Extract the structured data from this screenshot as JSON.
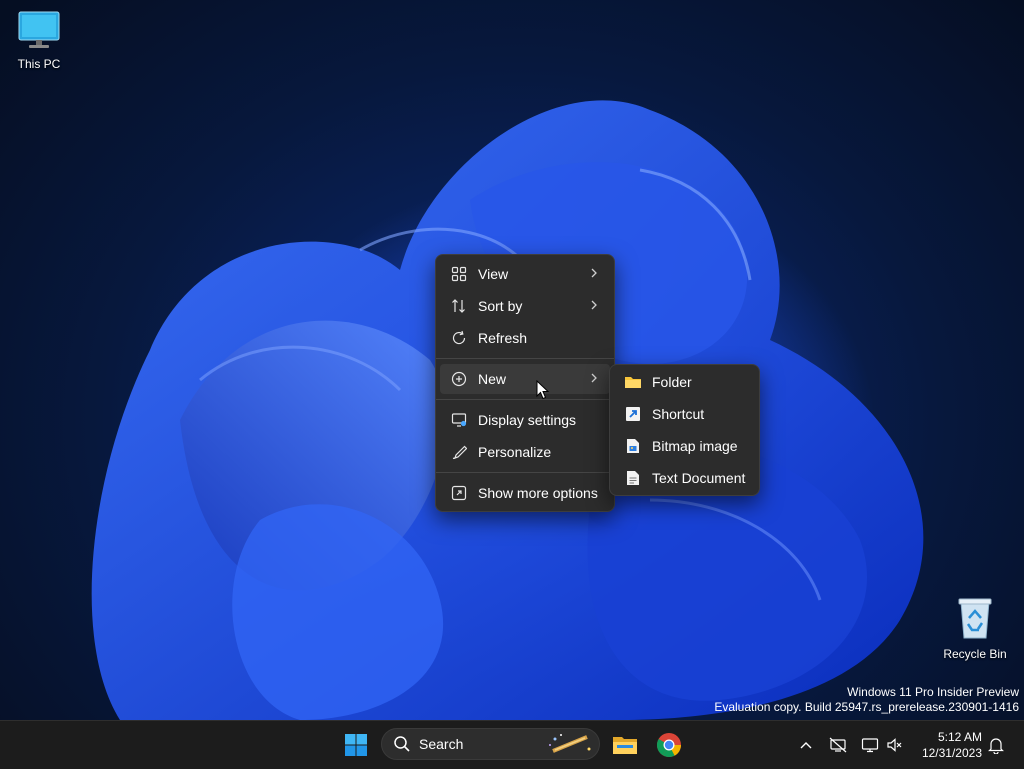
{
  "desktop": {
    "icons": [
      {
        "label": "This PC",
        "icon": "this-pc-icon"
      },
      {
        "label": "Recycle Bin",
        "icon": "recycle-bin-icon"
      }
    ],
    "watermark": {
      "line1": "Windows 11 Pro Insider Preview",
      "line2": "Evaluation copy. Build 25947.rs_prerelease.230901-1416"
    }
  },
  "context_menu": {
    "items": [
      {
        "label": "View",
        "icon": "view-grid-icon",
        "submenu": true
      },
      {
        "label": "Sort by",
        "icon": "sort-icon",
        "submenu": true
      },
      {
        "label": "Refresh",
        "icon": "refresh-icon",
        "submenu": false
      },
      {
        "label": "New",
        "icon": "new-plus-icon",
        "submenu": true,
        "highlighted": true
      },
      {
        "label": "Display settings",
        "icon": "display-settings-icon",
        "submenu": false
      },
      {
        "label": "Personalize",
        "icon": "personalize-brush-icon",
        "submenu": false
      },
      {
        "label": "Show more options",
        "icon": "show-more-options-icon",
        "submenu": false
      }
    ]
  },
  "new_submenu": {
    "items": [
      {
        "label": "Folder",
        "icon": "folder-icon"
      },
      {
        "label": "Shortcut",
        "icon": "shortcut-icon"
      },
      {
        "label": "Bitmap image",
        "icon": "bitmap-image-icon"
      },
      {
        "label": "Text Document",
        "icon": "text-document-icon"
      }
    ]
  },
  "taskbar": {
    "search_label": "Search",
    "pinned": [
      "start-icon",
      "search-icon",
      "file-explorer-icon",
      "chrome-icon"
    ],
    "tray": [
      "show-hidden-icons-chevron",
      "network-icon",
      "display-icon",
      "volume-muted-icon",
      "notification-bell-icon"
    ],
    "clock": {
      "time": "5:12 AM",
      "date": "12/31/2023"
    }
  },
  "colors": {
    "accent": "#1e4bd9",
    "menu_bg": "#2c2c2c",
    "taskbar_bg": "#1c1c1c"
  }
}
